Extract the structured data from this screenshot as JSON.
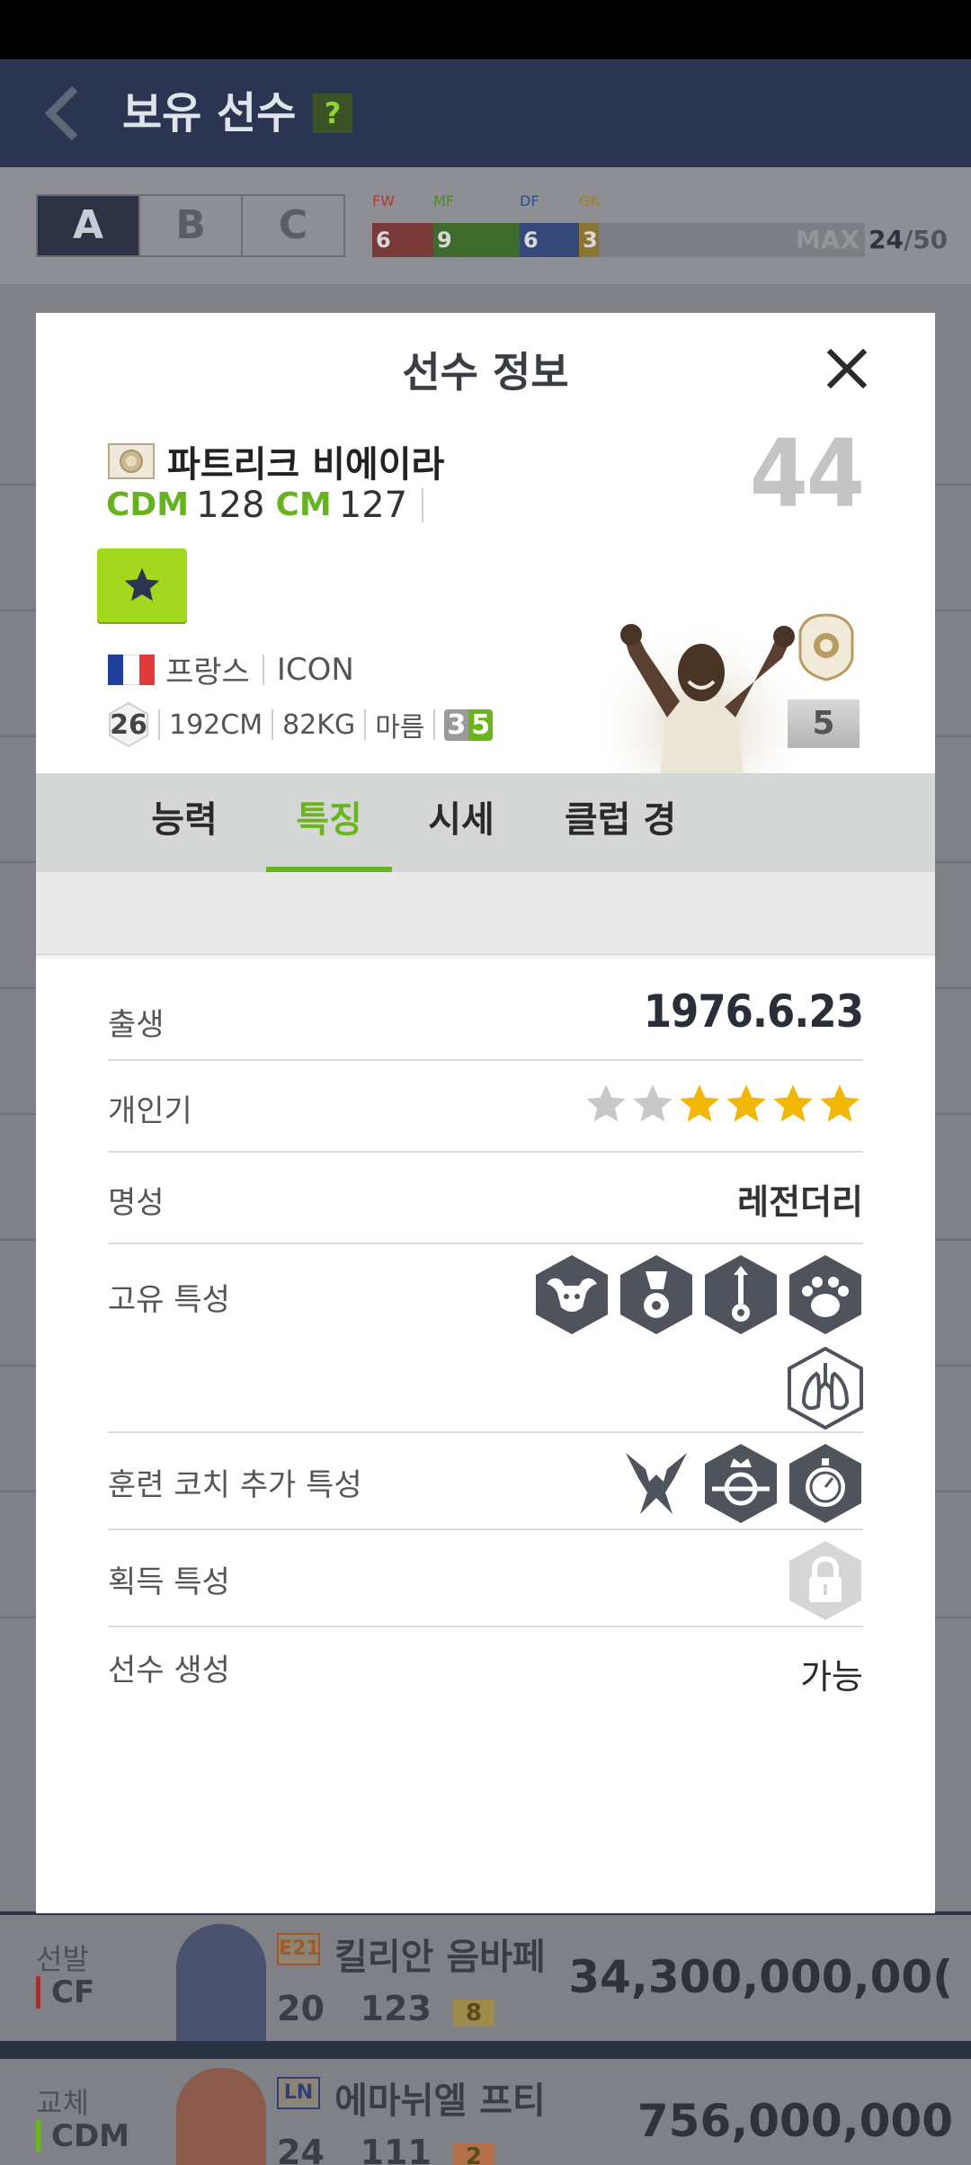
{
  "app": {
    "title": "보유 선수",
    "help": "?"
  },
  "squad": {
    "tabs": [
      "A",
      "B",
      "C"
    ],
    "active_tab": "A",
    "positions": [
      {
        "label": "FW",
        "count": "6",
        "color": "#b03a3a",
        "label_color": "#b03a3a"
      },
      {
        "label": "MF",
        "count": "9",
        "color": "#3d7a2b",
        "label_color": "#4f8a2a"
      },
      {
        "label": "DF",
        "count": "6",
        "color": "#2f4d86",
        "label_color": "#2f4d86"
      },
      {
        "label": "GK",
        "count": "3",
        "color": "#9a7b1c",
        "label_color": "#a08224"
      }
    ],
    "max_label": "MAX",
    "count": "24",
    "capacity": "/50"
  },
  "list_rows": [
    {
      "role": "선발",
      "position": "CF",
      "season": "E21",
      "name": "킬리안 음바페",
      "age": "20",
      "ovr": "123",
      "enhance": "8",
      "price": "34,300,000,00("
    },
    {
      "role": "교체",
      "position": "CDM",
      "season": "LN",
      "name": "에마뉘엘 프티",
      "age": "24",
      "ovr": "111",
      "enhance": "2",
      "price": "756,000,000"
    }
  ],
  "dialog": {
    "title": "선수 정보",
    "player": {
      "name": "파트리크 비에이라",
      "overall": "44",
      "positions": [
        {
          "code": "CDM",
          "value": "128"
        },
        {
          "code": "CM",
          "value": "127"
        }
      ],
      "grade_icon": "star-icon",
      "nation": "프랑스",
      "season": "ICON",
      "age": "26",
      "height": "192CM",
      "weight": "82KG",
      "body_type": "마름",
      "skill_moves_weak": "3",
      "skill_moves_strong": "5",
      "enhance_level": "5",
      "flag_colors": [
        "#1f3f9a",
        "#ffffff",
        "#e03a3a"
      ]
    },
    "tabs": [
      "능력치",
      "특징",
      "시세",
      "클럽 경력"
    ],
    "active_tab": "특징",
    "details": {
      "birth_label": "출생",
      "birth_value": "1976.6.23",
      "popularity_label": "개인기",
      "popularity_stars_total": 6,
      "popularity_stars_filled": 4,
      "reputation_label": "명성",
      "reputation_value": "레전더리",
      "unique_traits_label": "고유 특성",
      "unique_traits": [
        "bull-trait-icon",
        "dribble-ball-trait-icon",
        "long-shot-trait-icon",
        "paw-trait-icon",
        "lungs-trait-icon"
      ],
      "coach_traits_label": "훈련 코치 추가 특성",
      "coach_traits": [
        "tackle-trait-icon",
        "crown-target-trait-icon",
        "stopwatch-trait-icon"
      ],
      "acquired_traits_label": "획득 특성",
      "acquired_traits": [
        "lock-icon"
      ],
      "generate_label": "선수 생성",
      "generate_value": "가능"
    },
    "colors": {
      "accent": "#6bb51c",
      "star_filled": "#f2b705",
      "star_empty": "#c8c8c8",
      "trait_hex": "#4f535c"
    }
  }
}
